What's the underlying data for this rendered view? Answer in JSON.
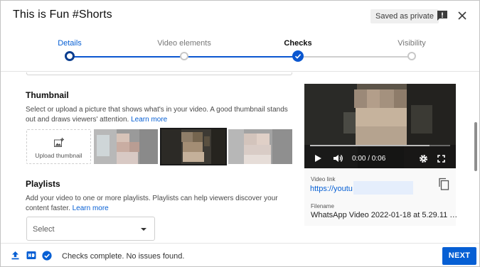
{
  "dialog": {
    "title": "This is Fun #Shorts",
    "saved_chip": "Saved as private",
    "icons": {
      "feedback": "feedback-icon",
      "close": "close-icon"
    }
  },
  "stepper": {
    "steps": [
      {
        "label": "Details",
        "state": "current"
      },
      {
        "label": "Video elements",
        "state": "pending"
      },
      {
        "label": "Checks",
        "state": "done"
      },
      {
        "label": "Visibility",
        "state": "pending"
      }
    ]
  },
  "thumbnail": {
    "title": "Thumbnail",
    "description": "Select or upload a picture that shows what's in your video. A good thumbnail stands out and draws viewers' attention.",
    "learn_more": "Learn more",
    "upload_label": "Upload thumbnail",
    "upload_icon": "add-photo-icon",
    "selected_index": 1
  },
  "playlists": {
    "title": "Playlists",
    "description": "Add your video to one or more playlists. Playlists can help viewers discover your content faster.",
    "learn_more": "Learn more",
    "select_value": "Select"
  },
  "preview": {
    "time": "0:00 / 0:06",
    "progress": 0,
    "video_link_label": "Video link",
    "video_link": "https://youtu",
    "filename_label": "Filename",
    "filename": "WhatsApp Video 2022-01-18 at 5.29.11 …",
    "icons": {
      "play": "play-icon",
      "volume": "volume-icon",
      "settings": "gear-icon",
      "fullscreen": "fullscreen-icon",
      "copy": "copy-icon"
    }
  },
  "footer": {
    "status": "Checks complete. No issues found.",
    "next_label": "NEXT",
    "icons": [
      "upload-icon",
      "hd-icon",
      "check-circle-icon"
    ]
  },
  "colors": {
    "accent": "#065fd4",
    "step_done": "#0b57d0"
  }
}
